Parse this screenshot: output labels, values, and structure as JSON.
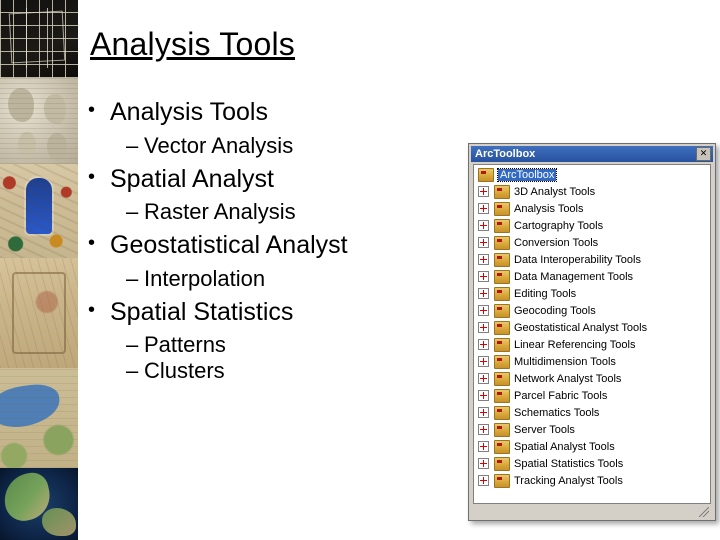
{
  "slide": {
    "title": "Analysis Tools",
    "bullets": [
      {
        "level": 1,
        "text": "Analysis Tools"
      },
      {
        "level": 2,
        "text": "Vector Analysis"
      },
      {
        "level": 1,
        "text": "Spatial Analyst"
      },
      {
        "level": 2,
        "text": "Raster Analysis"
      },
      {
        "level": 1,
        "text": "Geostatistical Analyst"
      },
      {
        "level": 2,
        "text": "Interpolation"
      },
      {
        "level": 1,
        "text": "Spatial Statistics"
      },
      {
        "level": 2,
        "text": "Patterns"
      },
      {
        "level": 2,
        "text": "Clusters"
      }
    ],
    "bullet_glyph": "•",
    "dash_glyph": "–"
  },
  "filmstrip": {
    "images": [
      {
        "name": "dark-grid-map-thumbnail"
      },
      {
        "name": "clay-tablet-thumbnail"
      },
      {
        "name": "historic-figure-map-thumbnail"
      },
      {
        "name": "parchment-map-thumbnail"
      },
      {
        "name": "mediterranean-map-thumbnail"
      },
      {
        "name": "satellite-earth-thumbnail"
      }
    ]
  },
  "toolbox": {
    "window_title": "ArcToolbox",
    "close_label": "✕",
    "root_label": "ArcToolbox",
    "items": [
      "3D Analyst Tools",
      "Analysis Tools",
      "Cartography Tools",
      "Conversion Tools",
      "Data Interoperability Tools",
      "Data Management Tools",
      "Editing Tools",
      "Geocoding Tools",
      "Geostatistical Analyst Tools",
      "Linear Referencing Tools",
      "Multidimension Tools",
      "Network Analyst Tools",
      "Parcel Fabric Tools",
      "Schematics Tools",
      "Server Tools",
      "Spatial Analyst Tools",
      "Spatial Statistics Tools",
      "Tracking Analyst Tools"
    ],
    "colors": {
      "titlebar": "#27529e",
      "selection": "#316ac5",
      "chrome": "#d4d0c8",
      "expander_plus": "#cc0000"
    }
  }
}
